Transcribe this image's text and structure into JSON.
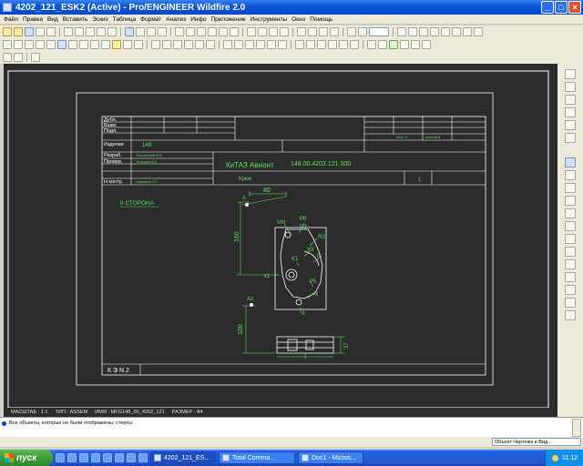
{
  "window": {
    "title": "4202_121_ESK2 (Active) - Pro/ENGINEER Wildfire 2.0"
  },
  "menu": [
    "Файл",
    "Правка",
    "Вид",
    "Вставить",
    "Эскиз",
    "Таблица",
    "Формат",
    "Анализ",
    "Инфо",
    "Приложение",
    "Инструменты",
    "Окно",
    "Помощь"
  ],
  "title_block": {
    "rows_left": [
      "Дубл.",
      "Взам.",
      "Подл.",
      "Изделие",
      "Разраб.",
      "Провер.",
      "Н.контр."
    ],
    "izdelie": "14В",
    "razrab_name": "Послыбаев В.Б.",
    "prover_name": "Тетерин И.Х.",
    "nkontr_name": "Глаказев О.Г.",
    "lit_values": [
      "лист 3",
      "листов 8"
    ],
    "org": "КиТАЗ Авионт",
    "doc_no": "148.00.4202.121.000",
    "part_name": "Крюк",
    "sheet_no": "1",
    "kez": "К Э N 2"
  },
  "drawing": {
    "side_label": "II СТОРОНА",
    "dim_80": "80",
    "dim_160": "160",
    "dim_100": "100",
    "dim_37": "37",
    "point_a": "A",
    "point_az": "Az",
    "labels": [
      "VIII",
      "P6",
      "D3",
      "R2",
      "XII",
      "IX",
      "K1",
      "X1",
      "P5",
      "X",
      "IX"
    ]
  },
  "info": {
    "scale": "МАСШТАБ : 1:1",
    "type": "ТИП : ASSEM",
    "name": "ИМЯ : MFG148_00_4202_121",
    "size": "РАЗМЕР : A4"
  },
  "message": "Все объекты, которые не были отображены, стерты.",
  "filter": "Объект Чертежа и Вид...",
  "taskbar": {
    "start": "пуск",
    "tasks": [
      "4202_121_ES...",
      "Total Comma...",
      "Doc1 - Micros..."
    ],
    "clock": "11:12"
  },
  "colors": {
    "canvas_bg": "#2c2c2c",
    "drawing_white": "#ffffff",
    "annotation_green": "#5ee05e",
    "title_blue": "#0a56d8"
  }
}
